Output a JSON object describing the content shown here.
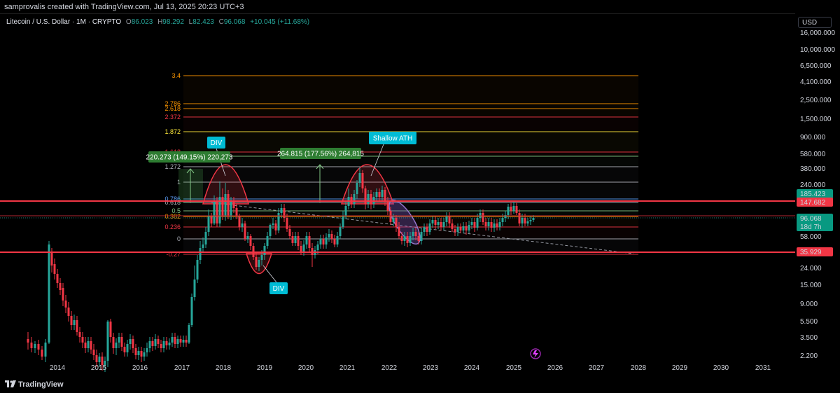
{
  "header": {
    "attribution": "samprovalis created with TradingView.com, Jul 13, 2025 20:23 UTC+3"
  },
  "legend": {
    "symbol": "Litecoin / U.S. Dollar · 1M · CRYPTO",
    "open_label": "O",
    "open": "86.023",
    "high_label": "H",
    "high": "98.292",
    "low_label": "L",
    "low": "82.423",
    "close_label": "C",
    "close": "96.068",
    "change": "+10.045 (+11.68%)"
  },
  "currency_button": "USD",
  "price_axis_labels": [
    "16,000.000",
    "10,000.000",
    "6,500.000",
    "4,100.000",
    "2,500.000",
    "1,500.000",
    "900.000",
    "580.000",
    "380.000",
    "240.000",
    "58.000",
    "24.000",
    "15.000",
    "9.000",
    "5.500",
    "3.500",
    "2.200"
  ],
  "price_tags": {
    "resistance": "185.423",
    "support_high": "147.682",
    "current": "96.068",
    "countdown": "18d 7h",
    "support_low": "35.929"
  },
  "time_axis_labels": [
    "2014",
    "2015",
    "2016",
    "2017",
    "2018",
    "2019",
    "2020",
    "2021",
    "2022",
    "2023",
    "2024",
    "2025",
    "2026",
    "2027",
    "2028",
    "2029",
    "2030",
    "2031"
  ],
  "fib_levels": [
    {
      "label": "3.4",
      "color": "#ff9800"
    },
    {
      "label": "2.786",
      "color": "#ff9800"
    },
    {
      "label": "2.618",
      "color": "#ff9800"
    },
    {
      "label": "2.372",
      "color": "#f23645"
    },
    {
      "label": "1.872",
      "color": "#ffeb3b"
    },
    {
      "label": "1.618",
      "color": "#f23645"
    },
    {
      "label": "1.4",
      "color": "#81c784"
    },
    {
      "label": "1.272",
      "color": "#b2b5be"
    },
    {
      "label": "1",
      "color": "#b2b5be"
    },
    {
      "label": "0.786",
      "color": "#5b9cf6"
    },
    {
      "label": "0.618",
      "color": "#b2b5be"
    },
    {
      "label": "0.5",
      "color": "#81c784"
    },
    {
      "label": "0.382",
      "color": "#ff9800"
    },
    {
      "label": "0.236",
      "color": "#f23645"
    },
    {
      "label": "0",
      "color": "#b2b5be"
    },
    {
      "label": "-0.27",
      "color": "#f23645"
    }
  ],
  "annotations": {
    "div_top": "DIV",
    "div_bottom": "DIV",
    "shallow_ath": "Shallow ATH",
    "measure_left": "220.273 (149.15%) 220,273",
    "measure_right": "264.815 (177.56%) 264,815"
  },
  "colors": {
    "bull": "#26a69a",
    "bear": "#f23645",
    "background": "#000000"
  },
  "footer": {
    "brand": "TradingView"
  }
}
